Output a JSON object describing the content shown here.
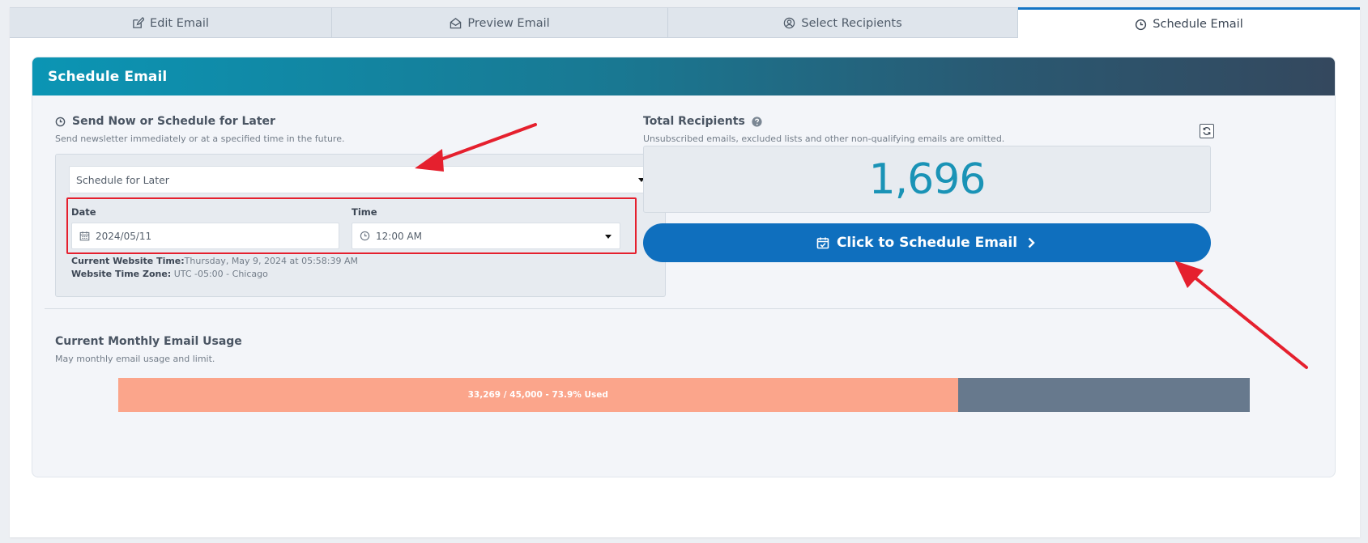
{
  "tabs": [
    {
      "label": "Edit Email",
      "icon": "edit-icon"
    },
    {
      "label": "Preview Email",
      "icon": "envelope-open-icon"
    },
    {
      "label": "Select Recipients",
      "icon": "user-circle-icon"
    },
    {
      "label": "Schedule Email",
      "icon": "clock-icon",
      "active": true
    }
  ],
  "panel": {
    "title": "Schedule Email",
    "header_gradient": [
      "#0b95b4",
      "#34485e"
    ]
  },
  "send": {
    "title": "Send Now or Schedule for Later",
    "subtitle": "Send newsletter immediately or at a specified time in the future.",
    "mode_selected": "Schedule for Later",
    "date_label": "Date",
    "date_value": "2024/05/11",
    "time_label": "Time",
    "time_value": "12:00 AM",
    "website_time_label": "Current Website Time:",
    "website_time_value": "Thursday, May 9, 2024 at 05:58:39 AM",
    "timezone_label": "Website Time Zone:",
    "timezone_value": "UTC -05:00 - Chicago"
  },
  "recipients": {
    "title": "Total Recipients",
    "subtitle": "Unsubscribed emails, excluded lists and other non-qualifying emails are omitted.",
    "count": "1,696",
    "schedule_button": "Click to Schedule Email"
  },
  "usage": {
    "title": "Current Monthly Email Usage",
    "subtitle": "May monthly email usage and limit.",
    "bar_label": "33,269 / 45,000 - 73.9% Used",
    "used_fraction": 0.742,
    "used_color": "#fba58b",
    "remaining_color": "#67798d"
  },
  "colors": {
    "accent": "#0f6fbe",
    "count": "#1a93b6",
    "annotation": "#e5202e"
  }
}
